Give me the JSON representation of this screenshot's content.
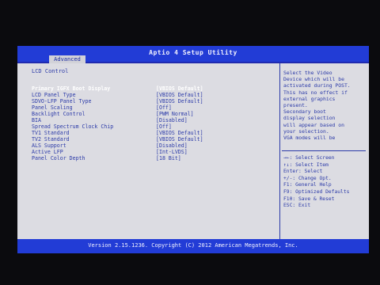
{
  "window": {
    "title": "Aptio 4 Setup Utility",
    "tab": "Advanced",
    "footer": "Version 2.15.1236. Copyright (C) 2012 American Megatrends, Inc."
  },
  "section": {
    "title": "LCD Control"
  },
  "options": [
    {
      "label": "Primary IGFX Boot Display",
      "value": "[VBIOS Default]"
    },
    {
      "label": "LCD Panel Type",
      "value": "[VBIOS Default]"
    },
    {
      "label": "SDVO-LFP Panel Type",
      "value": "[VBIOS Default]"
    },
    {
      "label": "Panel Scaling",
      "value": "[Off]"
    },
    {
      "label": "Backlight Control",
      "value": "[PWM Normal]"
    },
    {
      "label": "BIA",
      "value": "[Disabled]"
    },
    {
      "label": "Spread Spectrum Clock Chip",
      "value": "[Off]"
    },
    {
      "label": "TV1 Standard",
      "value": "[VBIOS Default]"
    },
    {
      "label": "TV2 Standard",
      "value": "[VBIOS Default]"
    },
    {
      "label": "ALS Support",
      "value": "[Disabled]"
    },
    {
      "label": "Active LFP",
      "value": "[Int-LVDS]"
    },
    {
      "label": "Panel Color Depth",
      "value": "[18 Bit]"
    }
  ],
  "help": [
    "Select the Video",
    "Device which will be",
    "activated during POST.",
    "This has no effect if",
    "external graphics",
    "present.",
    "Secondary boot",
    "display selection",
    "will appear based on",
    "your selection.",
    "VGA modes will be"
  ],
  "keys": [
    "→←: Select Screen",
    "↑↓: Select Item",
    "Enter: Select",
    "+/-: Change Opt.",
    "F1: General Help",
    "F9: Optimized Defaults",
    "F10: Save & Reset",
    "ESC: Exit"
  ]
}
